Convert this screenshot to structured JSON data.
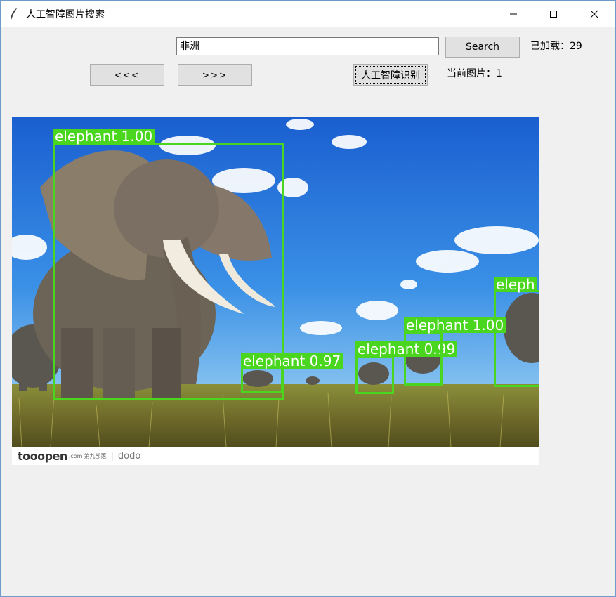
{
  "window": {
    "title": "人工智障图片搜索",
    "controls": {
      "minimize": "minimize-icon",
      "maximize": "maximize-icon",
      "close": "close-icon"
    }
  },
  "search": {
    "value": "非洲",
    "button_label": "Search"
  },
  "status": {
    "loaded_text": "已加载：29",
    "current_text": "当前图片：1"
  },
  "nav": {
    "prev_label": "<<<",
    "next_label": ">>>",
    "recognize_label": "人工智障识别"
  },
  "image": {
    "detections": [
      {
        "label": "elephant 1.00"
      },
      {
        "label": "elephant 0.97"
      },
      {
        "label": "elephant 0.99"
      },
      {
        "label": "elephant 1.00"
      },
      {
        "label": "eleph"
      }
    ],
    "box_color": "#4ad61f",
    "watermark": {
      "logo": "tooopen",
      "domain": ".com",
      "site_name": "第九部落",
      "user": "dodo"
    }
  }
}
